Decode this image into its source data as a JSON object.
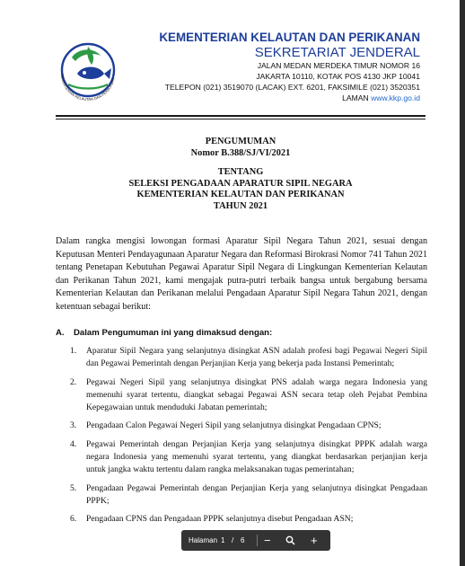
{
  "header": {
    "ministry": "KEMENTERIAN KELAUTAN DAN PERIKANAN",
    "secretariat": "SEKRETARIAT JENDERAL",
    "address1": "JALAN MEDAN MERDEKA TIMUR NOMOR 16",
    "address2": "JAKARTA 10110, KOTAK POS 4130 JKP 10041",
    "phone": "TELEPON (021) 3519070 (LACAK) EXT. 6201, FAKSIMILE (021) 3520351",
    "site_label": "LAMAN",
    "site_url": "www.kkp.go.id",
    "logo_text": "KEMENTERIAN KELAUTAN DAN PERIKANAN",
    "colors": {
      "brand_blue": "#1d3e9a",
      "logo_green": "#2e9a46",
      "link_blue": "#1f66c9"
    }
  },
  "doc": {
    "title": "PENGUMUMAN",
    "number": "Nomor B.388/SJ/VI/2021",
    "about": "TENTANG",
    "sub1": "SELEKSI PENGADAAN APARATUR SIPIL NEGARA",
    "sub2": "KEMENTERIAN KELAUTAN DAN PERIKANAN",
    "year": "TAHUN 2021",
    "intro": "Dalam rangka mengisi lowongan formasi Aparatur Sipil Negara Tahun 2021, sesuai dengan Keputusan Menteri Pendayagunaan Aparatur Negara dan Reformasi Birokrasi Nomor 741 Tahun 2021 tentang Penetapan Kebutuhan Pegawai Aparatur Sipil Negara di Lingkungan Kementerian Kelautan dan Perikanan Tahun 2021, kami mengajak putra-putri terbaik bangsa untuk bergabung bersama Kementerian Kelautan dan Perikanan melalui Pengadaan Aparatur Sipil Negara Tahun 2021, dengan ketentuan sebagai berikut:",
    "section_letter": "A.",
    "section_title": "Dalam Pengumuman ini yang dimaksud dengan:",
    "items": [
      {
        "num": "1.",
        "text": "Aparatur Sipil Negara yang selanjutnya disingkat ASN adalah profesi bagi Pegawai Negeri Sipil dan Pegawai Pemerintah dengan Perjanjian Kerja yang bekerja pada Instansi Pemerintah;"
      },
      {
        "num": "2.",
        "text": "Pegawai Negeri Sipil yang selanjutnya disingkat PNS adalah warga negara Indonesia yang memenuhi syarat tertentu, diangkat sebagai Pegawai ASN secara tetap oleh Pejabat Pembina Kepegawaian untuk menduduki Jabatan pemerintah;"
      },
      {
        "num": "3.",
        "text": "Pengadaan Calon Pegawai Negeri Sipil yang selanjutnya disingkat Pengadaan CPNS;"
      },
      {
        "num": "4.",
        "text": "Pegawai Pemerintah dengan Perjanjian Kerja yang selanjutnya disingkat PPPK adalah warga negara Indonesia yang memenuhi syarat tertentu, yang diangkat berdasarkan perjanjian kerja untuk jangka waktu tertentu dalam rangka melaksanakan tugas pemerintahan;"
      },
      {
        "num": "5.",
        "text": "Pengadaan Pegawai Pemerintah dengan Perjanjian Kerja yang selanjutnya disingkat Pengadaan PPPK;"
      },
      {
        "num": "6.",
        "text": "Pengadaan CPNS dan Pengadaan PPPK selanjutnya disebut Pengadaan ASN;"
      }
    ]
  },
  "viewer": {
    "page_label": "Halaman",
    "current_page": "1",
    "separator": "/",
    "total_pages": "6",
    "zoom_out": "−",
    "zoom_icon": "magnifier-icon",
    "zoom_in": "+"
  }
}
